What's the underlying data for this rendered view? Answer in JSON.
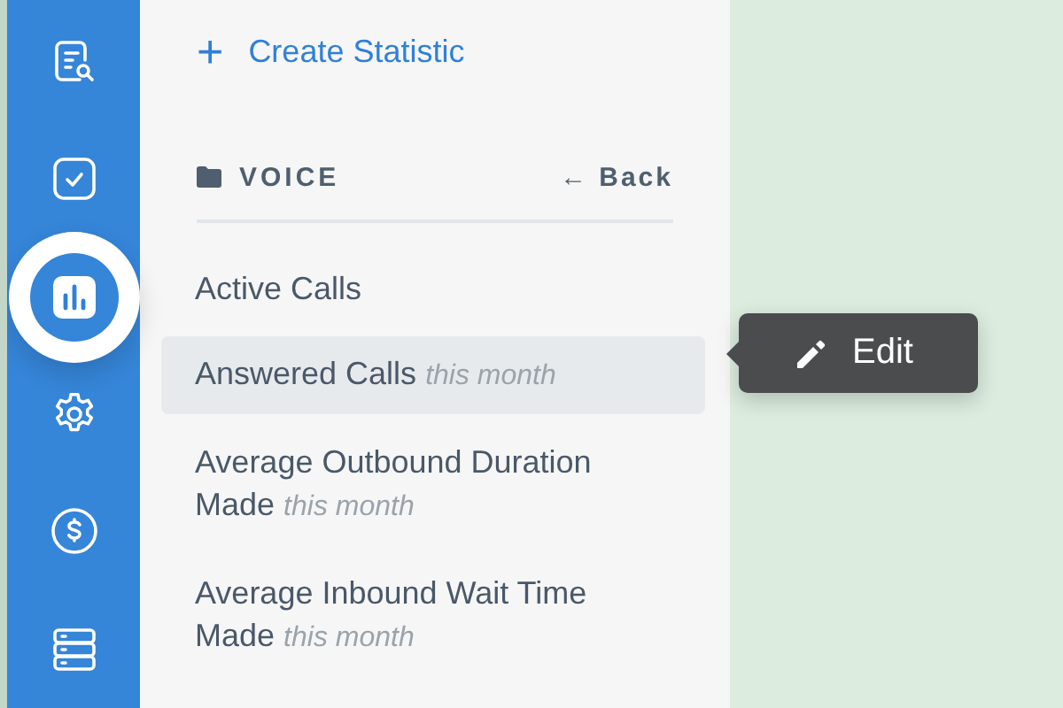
{
  "nav": [
    {
      "selected": false
    },
    {
      "selected": false
    },
    {
      "selected": true
    },
    {
      "selected": false
    },
    {
      "selected": false
    },
    {
      "selected": false
    }
  ],
  "create_link": {
    "icon": "+",
    "label": "Create Statistic"
  },
  "folder": {
    "name": "VOICE",
    "back": "← Back"
  },
  "statistics": [
    {
      "name": "Active Calls",
      "highlighted": false
    },
    {
      "name": "Answered Calls",
      "period": "this month",
      "highlighted": true
    },
    {
      "name": "Average Outbound Duration Made",
      "period": "this month",
      "highlighted": false
    },
    {
      "name": "Average Inbound Wait Time Made",
      "period": "this month",
      "highlighted": false
    }
  ],
  "tooltip": {
    "label": "Edit"
  }
}
